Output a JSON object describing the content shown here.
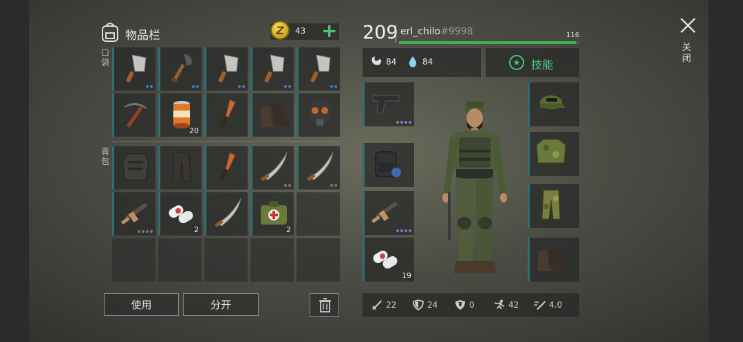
{
  "inventory": {
    "title": "物品栏",
    "coins": "43",
    "add_label": "+",
    "pockets_label": "口袋",
    "backpack_label": "背包",
    "pockets": [
      {
        "item": "cleaver",
        "count": "",
        "dots": [
          "#3a7fd0",
          "#3a7fd0"
        ]
      },
      {
        "item": "shovel",
        "count": "",
        "dots": [
          "#3a7fd0",
          "#3a7fd0"
        ]
      },
      {
        "item": "cleaver",
        "count": "",
        "dots": [
          "#3a7fd0",
          "#3a7fd0"
        ]
      },
      {
        "item": "cleaver",
        "count": "",
        "dots": [
          "#3a7fd0",
          "#3a7fd0"
        ]
      },
      {
        "item": "cleaver",
        "count": "",
        "dots": [
          "#3a7fd0",
          "#3a7fd0"
        ]
      },
      {
        "item": "pickaxe",
        "count": "",
        "dots": []
      },
      {
        "item": "canned-food",
        "count": "20",
        "dots": []
      },
      {
        "item": "knife",
        "count": "",
        "dots": []
      },
      {
        "item": "boots",
        "count": "",
        "dots": []
      },
      {
        "item": "gas-mask",
        "count": "",
        "dots": []
      }
    ],
    "backpack": [
      {
        "item": "armor-vest",
        "count": "",
        "dots": []
      },
      {
        "item": "pants",
        "count": "",
        "dots": []
      },
      {
        "item": "knife",
        "count": "",
        "dots": []
      },
      {
        "item": "machete",
        "count": "",
        "dots": [
          "#777",
          "#777"
        ]
      },
      {
        "item": "machete",
        "count": "",
        "dots": [
          "#777",
          "#777"
        ]
      },
      {
        "item": "assault-rifle",
        "count": "",
        "dots": [
          "#777",
          "#777",
          "#777",
          "#777"
        ]
      },
      {
        "item": "bandage",
        "count": "2",
        "dots": []
      },
      {
        "item": "machete",
        "count": "",
        "dots": []
      },
      {
        "item": "medkit",
        "count": "2",
        "dots": []
      },
      {
        "item": "",
        "count": "",
        "dots": []
      },
      {
        "item": "",
        "count": "",
        "dots": []
      },
      {
        "item": "",
        "count": "",
        "dots": []
      },
      {
        "item": "",
        "count": "",
        "dots": []
      },
      {
        "item": "",
        "count": "",
        "dots": []
      },
      {
        "item": "",
        "count": "",
        "dots": []
      }
    ],
    "use_button": "使用",
    "split_button": "分开"
  },
  "player": {
    "level": "209",
    "name": "erl_chilo",
    "id": "#9998",
    "hp": "116",
    "food": "84",
    "water": "84",
    "skills_label": "技能"
  },
  "equipment": {
    "left": [
      {
        "item": "pistol",
        "count": "",
        "dots": [
          "#5a8ad0",
          "#8a7ad0",
          "#8a7ad0",
          "#8a7ad0"
        ]
      },
      {
        "item": "backpack",
        "count": "",
        "dots": []
      },
      {
        "item": "assault-rifle",
        "count": "",
        "dots": [
          "#8a6ad0",
          "#8a6ad0",
          "#8a6ad0",
          "#8a6ad0"
        ]
      },
      {
        "item": "bandage",
        "count": "19",
        "dots": []
      }
    ],
    "right": [
      {
        "item": "cap",
        "count": "",
        "dots": []
      },
      {
        "item": "camo-jacket",
        "count": "",
        "dots": []
      },
      {
        "item": "camo-pants",
        "count": "",
        "dots": []
      },
      {
        "item": "boots",
        "count": "",
        "dots": []
      }
    ]
  },
  "stats": {
    "attack": "22",
    "defense": "24",
    "radiation": "0",
    "speed": "42",
    "attack_speed": "4.0"
  },
  "close_label": "关闭",
  "colors": {
    "accent": "#4fc37a",
    "slot_border": "#2f6f74",
    "hp": "#3fb34f"
  }
}
